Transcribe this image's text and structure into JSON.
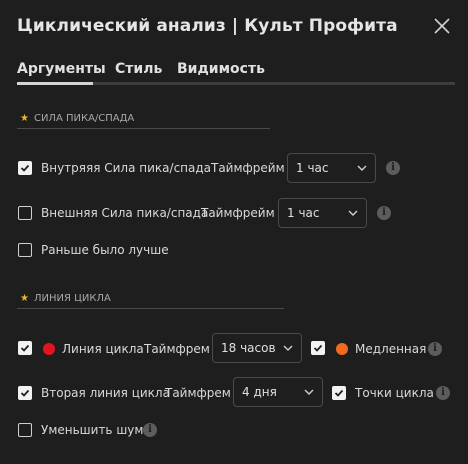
{
  "header": {
    "title": "Циклический анализ | Культ Профита",
    "close_icon": "close-icon"
  },
  "tabs": [
    {
      "label": "Аргументы",
      "active": true
    },
    {
      "label": "Стиль",
      "active": false
    },
    {
      "label": "Видимость",
      "active": false
    }
  ],
  "sections": {
    "peak": {
      "title": "СИЛА ПИКА/СПАДА"
    },
    "cycle": {
      "title": "ЛИНИЯ ЦИКЛА"
    }
  },
  "rows": {
    "internal": {
      "label": "Внутряяя Сила пика/спада",
      "tf_label": "Таймфрейм",
      "value": "1 час",
      "checked": true
    },
    "external": {
      "label": "Внешняя Сила пика/спада",
      "tf_label": "Таймфрейм",
      "value": "1 час",
      "checked": false
    },
    "earlier": {
      "label": "Раньше было лучше",
      "checked": false
    },
    "cycle_line": {
      "label": "Линия цикла",
      "tf_label": "Таймфрем",
      "value": "18 часов",
      "checked": true,
      "color": "#e3141f"
    },
    "slow": {
      "label": "Медленная",
      "checked": true,
      "color": "#f26a1b"
    },
    "second_cycle": {
      "label": "Вторая линия цикла",
      "tf_label": "Таймфрем",
      "value": "4 дня",
      "checked": true
    },
    "cycle_points": {
      "label": "Точки цикла",
      "checked": true
    },
    "reduce_noise": {
      "label": "Уменьшить шум",
      "checked": false
    }
  },
  "colors": {
    "accent_star": "#f0b429",
    "background": "#1e1e1e"
  }
}
